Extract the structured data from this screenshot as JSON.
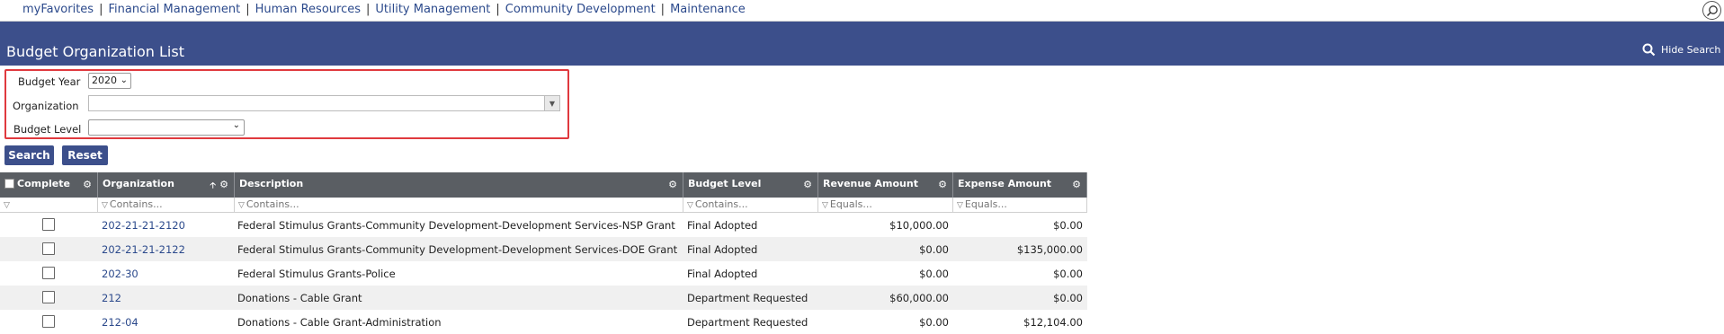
{
  "nav": {
    "links": [
      "myFavorites",
      "Financial Management",
      "Human Resources",
      "Utility Management",
      "Community Development",
      "Maintenance"
    ],
    "separator": "|"
  },
  "header": {
    "title": "Budget Organization List",
    "hide_search_label": "Hide Search"
  },
  "form": {
    "budget_year_label": "Budget Year",
    "budget_year_value": "2020",
    "organization_label": "Organization",
    "organization_value": "",
    "budget_level_label": "Budget Level",
    "budget_level_value": ""
  },
  "buttons": {
    "search": "Search",
    "reset": "Reset"
  },
  "table": {
    "columns": [
      "Complete",
      "Organization",
      "Description",
      "Budget Level",
      "Revenue Amount",
      "Expense Amount"
    ],
    "filter_placeholders": [
      "",
      "Contains...",
      "Contains...",
      "Contains...",
      "Equals...",
      "Equals..."
    ],
    "rows": [
      {
        "organization": "202-21-21-2120",
        "description": "Federal Stimulus Grants-Community Development-Development Services-NSP Grant",
        "budget_level": "Final Adopted",
        "revenue": "$10,000.00",
        "expense": "$0.00",
        "complete": false
      },
      {
        "organization": "202-21-21-2122",
        "description": "Federal Stimulus Grants-Community Development-Development Services-DOE Grant",
        "budget_level": "Final Adopted",
        "revenue": "$0.00",
        "expense": "$135,000.00",
        "complete": false
      },
      {
        "organization": "202-30",
        "description": "Federal Stimulus Grants-Police",
        "budget_level": "Final Adopted",
        "revenue": "$0.00",
        "expense": "$0.00",
        "complete": false
      },
      {
        "organization": "212",
        "description": "Donations - Cable Grant",
        "budget_level": "Department Requested",
        "revenue": "$60,000.00",
        "expense": "$0.00",
        "complete": false
      },
      {
        "organization": "212-04",
        "description": "Donations - Cable Grant-Administration",
        "budget_level": "Department Requested",
        "revenue": "$0.00",
        "expense": "$12,104.00",
        "complete": false
      }
    ]
  },
  "colors": {
    "header_bg": "#3c4f8b",
    "grid_header_bg": "#5a5e63",
    "link": "#2c4a8c",
    "highlight_border": "#e0393e"
  },
  "icons": {
    "global_search": "magnifier-icon",
    "column_menu": "gear-icon",
    "filter": "funnel-icon",
    "sort": "arrow-up-icon"
  }
}
